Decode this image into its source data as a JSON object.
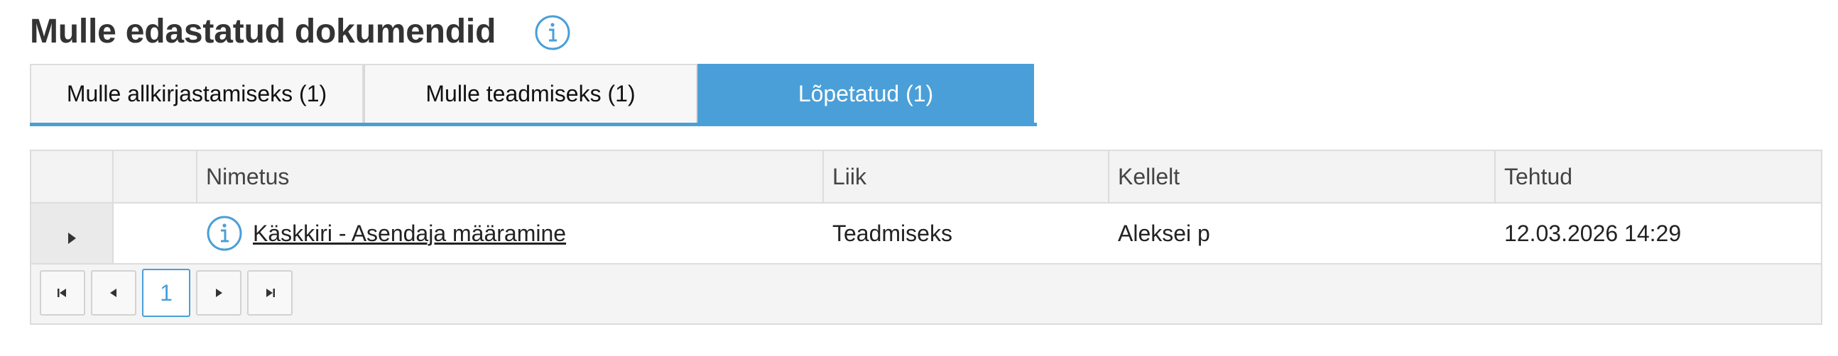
{
  "page": {
    "title": "Mulle edastatud dokumendid",
    "info_icon": "info-circle-icon"
  },
  "tabs": [
    {
      "label": "Mulle allkirjastamiseks (1)",
      "active": false
    },
    {
      "label": "Mulle teadmiseks (1)",
      "active": false
    },
    {
      "label": "Lõpetatud (1)",
      "active": true
    }
  ],
  "colors": {
    "accent": "#4a9fd8",
    "header_bg": "#f3f3f3",
    "border": "#dcdcdc"
  },
  "table": {
    "columns": [
      "",
      "",
      "Nimetus",
      "Liik",
      "Kellelt",
      "Tehtud"
    ],
    "rows": [
      {
        "name": "Käskkiri - Asendaja määramine",
        "type": "Teadmiseks",
        "from": "Aleksei p",
        "done": "12.03.2026 14:29"
      }
    ]
  },
  "pager": {
    "first_icon": "first-page-icon",
    "prev_icon": "prev-page-icon",
    "current_page": "1",
    "next_icon": "next-page-icon",
    "last_icon": "last-page-icon"
  }
}
